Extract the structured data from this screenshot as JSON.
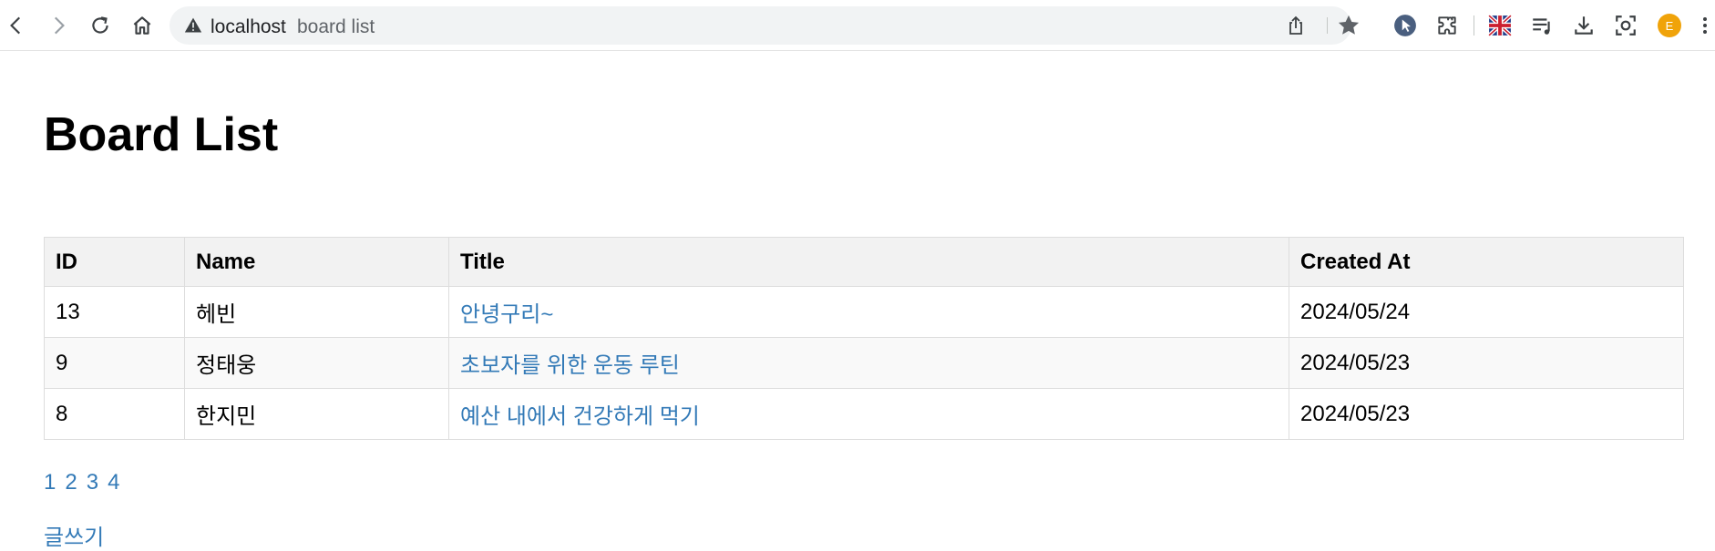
{
  "browser": {
    "address_host": "localhost",
    "address_path": "board list",
    "profile_initial": "E"
  },
  "page": {
    "title": "Board List",
    "table": {
      "headers": {
        "id": "ID",
        "name": "Name",
        "title": "Title",
        "created_at": "Created At"
      },
      "rows": [
        {
          "id": "13",
          "name": "헤빈",
          "title": "안녕구리~",
          "created_at": "2024/05/24"
        },
        {
          "id": "9",
          "name": "정태웅",
          "title": "초보자를 위한 운동 루틴",
          "created_at": "2024/05/23"
        },
        {
          "id": "8",
          "name": "한지민",
          "title": "예산 내에서 건강하게 먹기",
          "created_at": "2024/05/23"
        }
      ]
    },
    "pagination": [
      "1",
      "2",
      "3",
      "4"
    ],
    "write_link": "글쓰기"
  }
}
